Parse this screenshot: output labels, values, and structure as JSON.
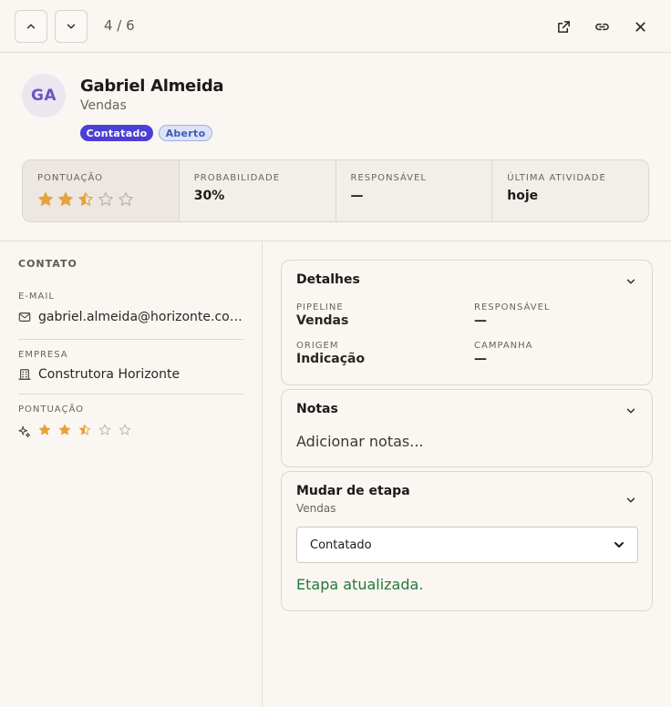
{
  "topbar": {
    "counter": "4 / 6",
    "icons": [
      "chevron-up-icon",
      "chevron-down-icon",
      "external-link-icon",
      "link-icon",
      "close-icon"
    ]
  },
  "lead": {
    "initials": "GA",
    "name": "Gabriel Almeida",
    "subtitle": "Vendas",
    "stage_badge": "Contatado",
    "status_badge": "Aberto"
  },
  "stats": {
    "score_label": "PONTUAÇÃO",
    "score_value": 2.5,
    "score_max": 5,
    "probability_label": "PROBABILIDADE",
    "probability_value": "30%",
    "owner_label": "RESPONSÁVEL",
    "owner_value": "—",
    "last_activity_label": "ÚLTIMA ATIVIDADE",
    "last_activity_value": "hoje"
  },
  "contact": {
    "section_title": "CONTATO",
    "email_label": "E-MAIL",
    "email_value": "gabriel.almeida@horizonte.com.br",
    "company_label": "EMPRESA",
    "company_value": "Construtora Horizonte",
    "score_label": "PONTUAÇÃO",
    "score_value": 2.5
  },
  "details": {
    "title": "Detalhes",
    "pipeline_label": "PIPELINE",
    "pipeline_value": "Vendas",
    "owner_label": "RESPONSÁVEL",
    "owner_value": "—",
    "origin_label": "ORIGEM",
    "origin_value": "Indicação",
    "campaign_label": "CAMPANHA",
    "campaign_value": "—"
  },
  "notes": {
    "title": "Notas",
    "placeholder": "Adicionar notas..."
  },
  "stage_change": {
    "title": "Mudar de etapa",
    "subtitle": "Vendas",
    "selected": "Contatado",
    "success_message": "Etapa atualizada."
  },
  "colors": {
    "accent": "#4b3fd6",
    "star": "#e8a23a",
    "success": "#23793a"
  }
}
